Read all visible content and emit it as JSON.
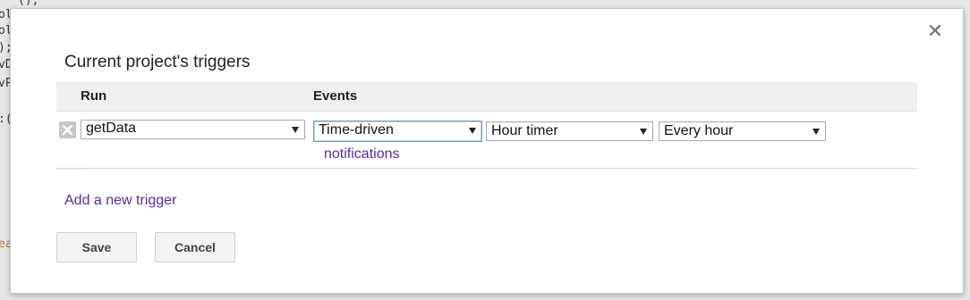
{
  "background": {
    "code_fragments": [
      "ol",
      "ol",
      ");",
      "vD",
      "vP",
      ":(",
      "ea"
    ],
    "top_fragment": "();"
  },
  "dialog": {
    "close_glyph": "✕",
    "title": "Current project's triggers",
    "columns": {
      "run": "Run",
      "events": "Events"
    },
    "trigger": {
      "run_function": "getData",
      "event_source": "Time-driven",
      "timer_type": "Hour timer",
      "interval": "Every hour",
      "notifications_link": "notifications"
    },
    "add_trigger_link": "Add a new trigger",
    "buttons": {
      "save": "Save",
      "cancel": "Cancel"
    }
  },
  "colors": {
    "link": "#5a2aa6",
    "focus_border": "#6f9bd9",
    "header_bg": "#efefef"
  },
  "icons": {
    "delete": "x-icon",
    "close": "close-icon",
    "dropdown": "dropdown-caret-icon"
  }
}
